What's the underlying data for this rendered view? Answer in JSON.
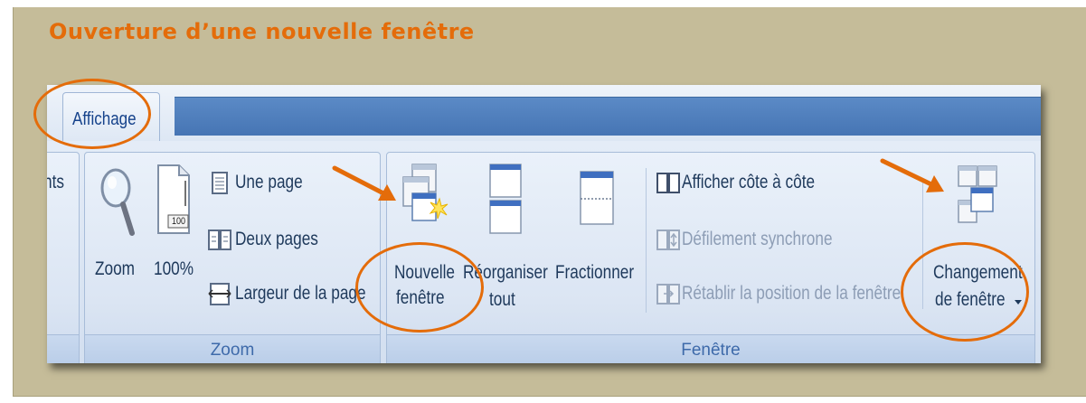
{
  "slide": {
    "title": "Ouverture d’une nouvelle fenêtre"
  },
  "ribbon": {
    "active_tab": "Affichage",
    "left_truncated": "nts",
    "zoom_group": {
      "label": "Zoom",
      "zoom_button": "Zoom",
      "percent_button": "100%",
      "percent_icon_text": "100",
      "one_page": "Une page",
      "two_pages": "Deux pages",
      "page_width": "Largeur de la page"
    },
    "window_group": {
      "label": "Fenêtre",
      "new_window_line1": "Nouvelle",
      "new_window_line2": "fenêtre",
      "arrange_line1": "Réorganiser",
      "arrange_line2": "tout",
      "split": "Fractionner",
      "side_by_side": "Afficher côte à côte",
      "sync_scroll": "Défilement synchrone",
      "reset_position": "Rétablir la position de la fenêtre",
      "switch_line1": "Changement",
      "switch_line2": "de fenêtre"
    }
  },
  "colors": {
    "annotation": "#e46c0a",
    "slide_background": "#c5bc99",
    "tab_bar": "#4f81bd"
  }
}
